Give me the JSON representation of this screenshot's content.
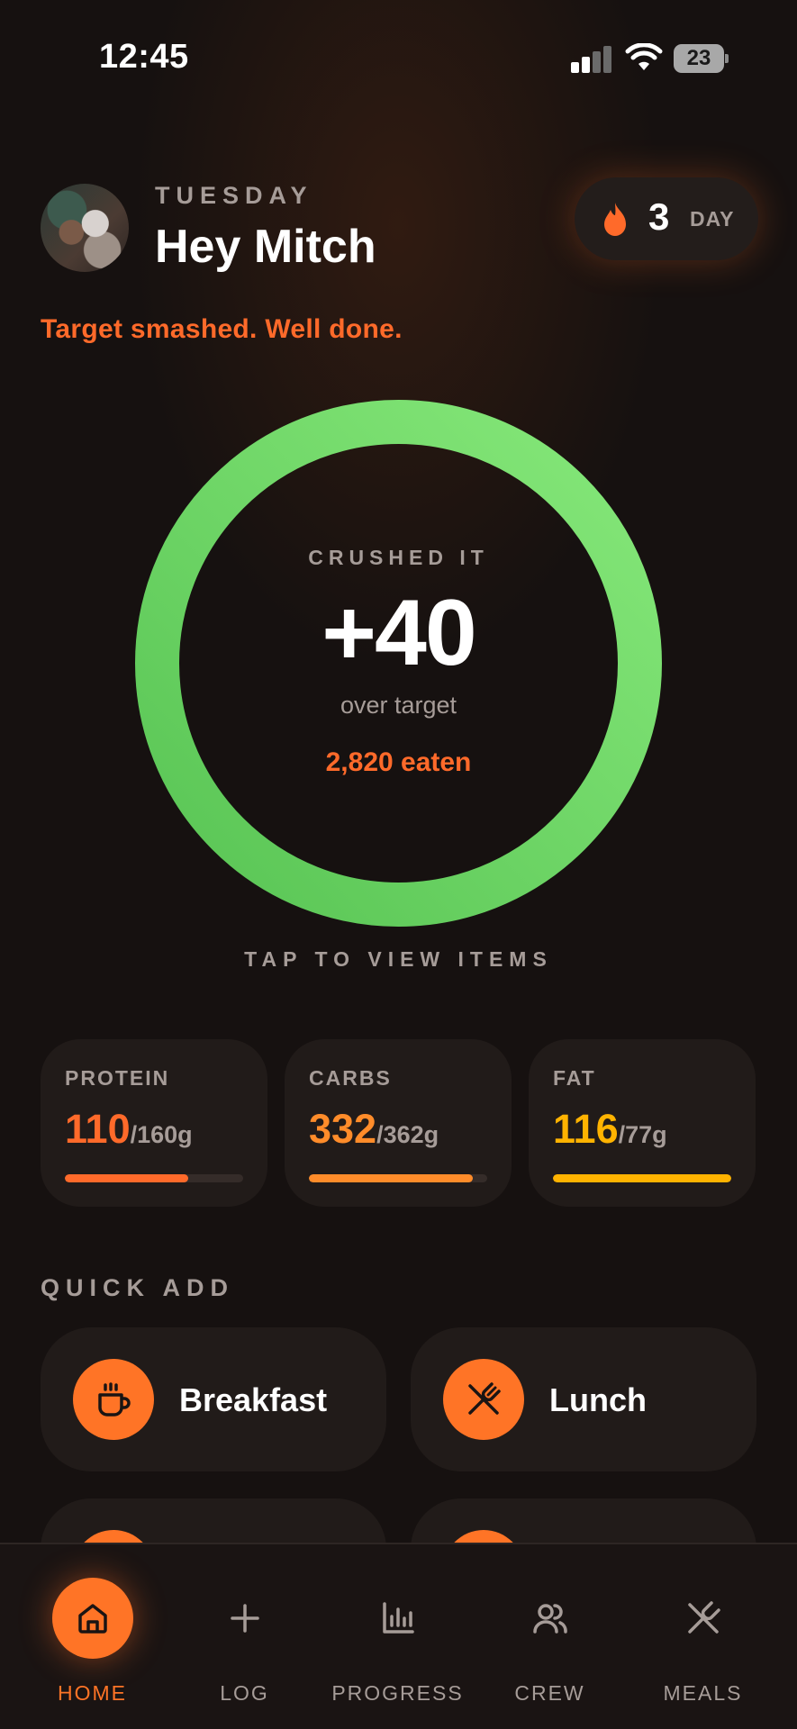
{
  "status_bar": {
    "time": "12:45",
    "battery": "23"
  },
  "header": {
    "day": "TUESDAY",
    "greeting": "Hey Mitch",
    "streak": {
      "count": "3",
      "unit": "DAY"
    },
    "message": "Target smashed. Well done."
  },
  "ring": {
    "status": "CRUSHED IT",
    "value": "+40",
    "sub": "over target",
    "eaten": "2,820 eaten",
    "tap_hint": "TAP TO VIEW ITEMS",
    "color": "#6cd865"
  },
  "macros": [
    {
      "title": "PROTEIN",
      "value": "110",
      "target": "/160g",
      "progress": 0.69,
      "color": "#ff6a2a"
    },
    {
      "title": "CARBS",
      "value": "332",
      "target": "/362g",
      "progress": 0.92,
      "color": "#ff8c2a"
    },
    {
      "title": "FAT",
      "value": "116",
      "target": "/77g",
      "progress": 1.0,
      "color": "#ffb300"
    }
  ],
  "quick_add": {
    "title": "QUICK ADD",
    "items": [
      {
        "label": "Breakfast",
        "icon": "coffee-cup-icon"
      },
      {
        "label": "Lunch",
        "icon": "utensils-icon"
      }
    ]
  },
  "nav": [
    {
      "label": "HOME",
      "icon": "home-icon",
      "active": true
    },
    {
      "label": "LOG",
      "icon": "plus-icon",
      "active": false
    },
    {
      "label": "PROGRESS",
      "icon": "bar-chart-icon",
      "active": false
    },
    {
      "label": "CREW",
      "icon": "users-icon",
      "active": false
    },
    {
      "label": "MEALS",
      "icon": "utensils-icon",
      "active": false
    }
  ],
  "colors": {
    "accent": "#ff7426",
    "background": "#161110",
    "card": "#211b19",
    "muted": "#a69c98"
  }
}
